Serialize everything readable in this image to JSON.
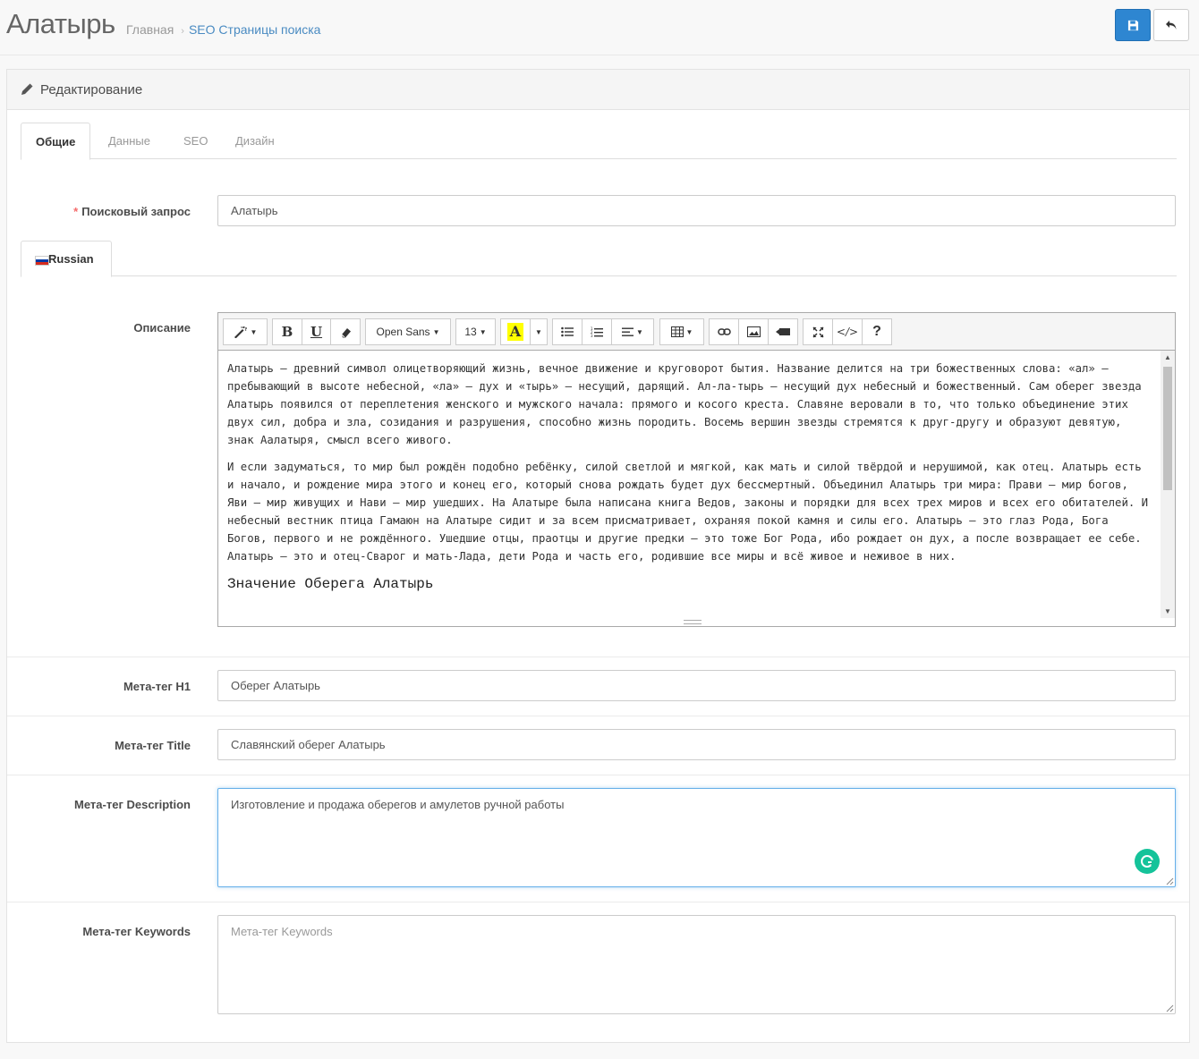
{
  "header": {
    "title": "Алатырь",
    "breadcrumb": [
      "Главная",
      "SEO Страницы поиска"
    ],
    "save_icon": "floppy-disk-icon",
    "back_icon": "reply-icon"
  },
  "panel": {
    "title": "Редактирование",
    "icon": "pencil-icon"
  },
  "tabs": [
    "Общие",
    "Данные",
    "SEO",
    "Дизайн"
  ],
  "active_tab": "Общие",
  "fields": {
    "query_label": "Поисковый запрос",
    "query_required": "*",
    "query_value": "Алатырь",
    "language_tab": "Russian",
    "description_label": "Описание",
    "h1_label": "Мета-тег H1",
    "h1_value": "Оберег Алатырь",
    "title_label": "Мета-тег Title",
    "title_value": "Славянский оберег Алатырь",
    "desc_label": "Мета-тег Description",
    "desc_value": "Изготовление и продажа оберегов и амулетов ручной работы",
    "keywords_label": "Мета-тег Keywords",
    "keywords_placeholder": "Мета-тег Keywords"
  },
  "editor": {
    "font_name": "Open Sans",
    "font_size": "13",
    "toolbar_icons": [
      "magic-wand-icon",
      "bold-icon",
      "underline-icon",
      "eraser-icon",
      "font-family-dropdown",
      "font-size-dropdown",
      "text-color-icon",
      "unordered-list-icon",
      "ordered-list-icon",
      "align-icon",
      "table-icon",
      "link-icon",
      "picture-icon",
      "video-icon",
      "fullscreen-icon",
      "code-view-icon",
      "help-icon"
    ],
    "bold_glyph": "B",
    "underline_glyph": "U",
    "color_glyph": "A",
    "code_glyph": "</>",
    "help_glyph": "?",
    "paragraphs": [
      "Алатырь – древний символ олицетворяющий жизнь, вечное движение и круговорот бытия. Название делится на три божественных слова: «ал» — пребывающий в высоте небесной, «ла» — дух и «тырь» — несущий, дарящий. Ал-ла-тырь — несущий дух небесный и божественный. Сам оберег звезда Алатырь появился от переплетения женского и мужского начала: прямого и косого креста. Славяне веровали в то, что только объединение этих двух сил, добра и зла, созидания и разрушения, способно жизнь породить. Восемь вершин звезды стремятся к друг-другу и образуют девятую, знак Аалатыря, смысл всего живого.",
      "И если задуматься, то мир был рождён подобно ребёнку, силой светлой и мягкой, как мать и силой твёрдой и нерушимой, как отец. Алатырь есть и начало, и рождение мира этого и конец его, который снова рождать будет дух бессмертный. Объединил Алатырь три мира: Прави – мир богов, Яви – мир живущих и Нави – мир ушедших. На Алатыре была написана книга Ведов, законы и порядки для всех трех миров и всех его обитателей. И небесный вестник птица Гамаюн на Алатыре сидит и за всем присматривает, охраняя покой камня и силы его. Алатырь – это глаз Рода, Бога Богов, первого и не рождённого. Ушедшие отцы, праотцы и другие предки — это тоже Бог Рода, ибо рождает он дух, а после возвращает ее себе. Алатырь – это и отец-Сварог и мать-Лада, дети Рода и часть его, родившие все миры и всё живое и неживое в них."
    ],
    "heading": "Значение Оберега Алатырь"
  },
  "colors": {
    "primary": "#2e86d1",
    "link": "#4a8bc2",
    "required": "#f56b6b",
    "highlight": "#ffff00",
    "grammarly": "#15c39a"
  }
}
